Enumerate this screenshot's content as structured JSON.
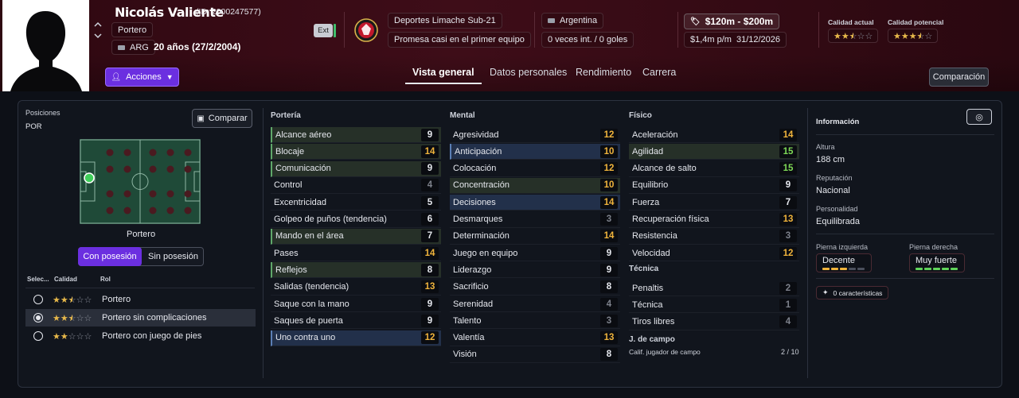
{
  "header": {
    "name": "Nicolás Valiente",
    "id_text": "(ID: 2000247577)",
    "position": "Portero",
    "nationality_code": "ARG",
    "age_text": "20 años (27/2/2004)",
    "ext_label": "Ext",
    "club": "Deportes Limache Sub-21",
    "club_status": "Promesa casi en el primer equipo",
    "country": "Argentina",
    "caps": "0 veces int. / 0 goles",
    "value": "$120m - $200m",
    "wage": "$1,4m p/m",
    "contract_end": "31/12/2026",
    "current_ability_label": "Calidad actual",
    "potential_ability_label": "Calidad potencial",
    "current_ability_stars": 2.5,
    "potential_ability_stars": 3.5,
    "actions_label": "Acciones",
    "compare_label": "Comparación"
  },
  "tabs": [
    "Vista general",
    "Datos personales",
    "Rendimiento",
    "Carrera"
  ],
  "active_tab": "Vista general",
  "positions": {
    "title": "Posiciones",
    "value": "POR",
    "compare_button": "Comparar",
    "pitch_caption": "Portero",
    "toggle_on": "Con posesión",
    "toggle_off": "Sin posesión",
    "col_select": "Selec...",
    "col_quality": "Calidad",
    "col_role": "Rol",
    "roles": [
      {
        "name": "Portero",
        "stars": 2.5,
        "selected": false
      },
      {
        "name": "Portero sin complicaciones",
        "stars": 2.5,
        "selected": true
      },
      {
        "name": "Portero con juego de pies",
        "stars": 2,
        "selected": false
      }
    ]
  },
  "attributes": {
    "porteria": {
      "title": "Portería",
      "items": [
        {
          "name": "Alcance aéreo",
          "value": "9"
        },
        {
          "name": "Blocaje",
          "value": "14"
        },
        {
          "name": "Comunicación",
          "value": "9"
        },
        {
          "name": "Control",
          "value": "4"
        },
        {
          "name": "Excentricidad",
          "value": "5"
        },
        {
          "name": "Golpeo de puños (tendencia)",
          "value": "6"
        },
        {
          "name": "Mando en el área",
          "value": "7"
        },
        {
          "name": "Pases",
          "value": "14"
        },
        {
          "name": "Reflejos",
          "value": "8"
        },
        {
          "name": "Salidas (tendencia)",
          "value": "13"
        },
        {
          "name": "Saque con la mano",
          "value": "9"
        },
        {
          "name": "Saques de puerta",
          "value": "9"
        },
        {
          "name": "Uno contra uno",
          "value": "12"
        }
      ]
    },
    "mental": {
      "title": "Mental",
      "items": [
        {
          "name": "Agresividad",
          "value": "12"
        },
        {
          "name": "Anticipación",
          "value": "10"
        },
        {
          "name": "Colocación",
          "value": "12"
        },
        {
          "name": "Concentración",
          "value": "10"
        },
        {
          "name": "Decisiones",
          "value": "14"
        },
        {
          "name": "Desmarques",
          "value": "3"
        },
        {
          "name": "Determinación",
          "value": "14"
        },
        {
          "name": "Juego en equipo",
          "value": "9"
        },
        {
          "name": "Liderazgo",
          "value": "9"
        },
        {
          "name": "Sacrificio",
          "value": "8"
        },
        {
          "name": "Serenidad",
          "value": "4"
        },
        {
          "name": "Talento",
          "value": "3"
        },
        {
          "name": "Valentía",
          "value": "13"
        },
        {
          "name": "Visión",
          "value": "8"
        }
      ]
    },
    "fisico": {
      "title": "Físico",
      "items": [
        {
          "name": "Aceleración",
          "value": "14"
        },
        {
          "name": "Agilidad",
          "value": "15"
        },
        {
          "name": "Alcance de salto",
          "value": "15"
        },
        {
          "name": "Equilibrio",
          "value": "9"
        },
        {
          "name": "Fuerza",
          "value": "7"
        },
        {
          "name": "Recuperación física",
          "value": "13"
        },
        {
          "name": "Resistencia",
          "value": "3"
        },
        {
          "name": "Velocidad",
          "value": "12"
        }
      ]
    },
    "tecnica": {
      "title": "Técnica",
      "items": [
        {
          "name": "Penaltis",
          "value": "2"
        },
        {
          "name": "Técnica",
          "value": "1"
        },
        {
          "name": "Tiros libres",
          "value": "4"
        }
      ]
    },
    "jcampo": {
      "title": "J. de campo",
      "label": "Calif. jugador de campo",
      "value": "2 / 10"
    }
  },
  "info": {
    "title": "Información",
    "height_label": "Altura",
    "height": "188 cm",
    "reputation_label": "Reputación",
    "reputation": "Nacional",
    "personality_label": "Personalidad",
    "personality": "Equilibrada",
    "left_foot_label": "Pierna izquierda",
    "left_foot": "Decente",
    "left_foot_level": 3,
    "right_foot_label": "Pierna derecha",
    "right_foot": "Muy fuerte",
    "right_foot_level": 5,
    "traits": "0 características"
  },
  "colors": {
    "yellow": "#f0b43c",
    "green": "#7ed957",
    "white": "#e6e8ee",
    "grey": "#7d818b",
    "accent_purple": "#6b2fe0"
  }
}
